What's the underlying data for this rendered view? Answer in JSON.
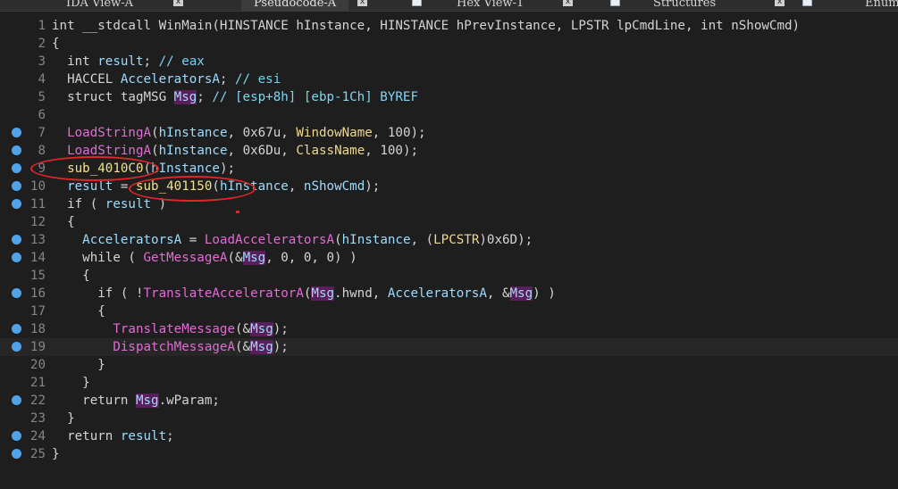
{
  "tabs": [
    {
      "label": "IDA View-A"
    },
    {
      "label": "Pseudocode-A"
    },
    {
      "label": "Hex View-1"
    },
    {
      "label": "Structures"
    },
    {
      "label": "Enums"
    }
  ],
  "tab_close_glyph": "x",
  "code": {
    "lines": [
      {
        "n": "1",
        "t": "int __stdcall WinMain(HINSTANCE hInstance, HINSTANCE hPrevInstance, LPSTR lpCmdLine, int nShowCmd)"
      },
      {
        "n": "2",
        "t": "{"
      },
      {
        "n": "3",
        "t": "  int result; // eax"
      },
      {
        "n": "4",
        "t": "  HACCEL AcceleratorsA; // esi"
      },
      {
        "n": "5",
        "t": "  struct tagMSG Msg; // [esp+8h] [ebp-1Ch] BYREF"
      },
      {
        "n": "6",
        "t": ""
      },
      {
        "n": "7",
        "t": "  LoadStringA(hInstance, 0x67u, WindowName, 100);"
      },
      {
        "n": "8",
        "t": "  LoadStringA(hInstance, 0x6Du, ClassName, 100);"
      },
      {
        "n": "9",
        "t": "  sub_4010C0(hInstance);"
      },
      {
        "n": "10",
        "t": "  result = sub_401150(hInstance, nShowCmd);"
      },
      {
        "n": "11",
        "t": "  if ( result )"
      },
      {
        "n": "12",
        "t": "  {"
      },
      {
        "n": "13",
        "t": "    AcceleratorsA = LoadAcceleratorsA(hInstance, (LPCSTR)0x6D);"
      },
      {
        "n": "14",
        "t": "    while ( GetMessageA(&Msg, 0, 0, 0) )"
      },
      {
        "n": "15",
        "t": "    {"
      },
      {
        "n": "16",
        "t": "      if ( !TranslateAcceleratorA(Msg.hwnd, AcceleratorsA, &Msg) )"
      },
      {
        "n": "17",
        "t": "      {"
      },
      {
        "n": "18",
        "t": "        TranslateMessage(&Msg);"
      },
      {
        "n": "19",
        "t": "        DispatchMessageA(&Msg);"
      },
      {
        "n": "20",
        "t": "      }"
      },
      {
        "n": "21",
        "t": "    }"
      },
      {
        "n": "22",
        "t": "    return Msg.wParam;"
      },
      {
        "n": "23",
        "t": "  }"
      },
      {
        "n": "24",
        "t": "  return result;"
      },
      {
        "n": "25",
        "t": "}"
      }
    ]
  },
  "colors": {
    "background": "#1e1e1e",
    "breakpoint": "#4fa3e8",
    "annotation": "#e0262a",
    "function": "#e36bd6",
    "identifier": "#9cdcfe",
    "global": "#f0d78c"
  }
}
